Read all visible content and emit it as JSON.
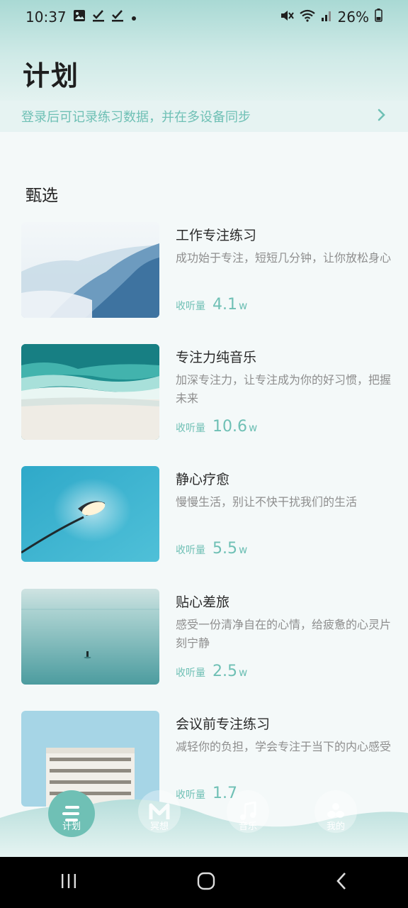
{
  "status_bar": {
    "time": "10:37",
    "battery": "26%"
  },
  "page": {
    "title": "计划"
  },
  "login_banner": {
    "text": "登录后可记录练习数据，并在多设备同步"
  },
  "section": {
    "title": "甄选"
  },
  "items": [
    {
      "title": "工作专注练习",
      "desc": "成功始于专注，短短几分钟，让你放松身心",
      "count_label": "收听量",
      "count": "4.1",
      "unit": "w"
    },
    {
      "title": "专注力纯音乐",
      "desc": "加深专注力，让专注成为你的好习惯，把握未来",
      "count_label": "收听量",
      "count": "10.6",
      "unit": "w"
    },
    {
      "title": "静心疗愈",
      "desc": "慢慢生活，别让不快干扰我们的生活",
      "count_label": "收听量",
      "count": "5.5",
      "unit": "w"
    },
    {
      "title": "贴心差旅",
      "desc": "感受一份清净自在的心情，给疲惫的心灵片刻宁静",
      "count_label": "收听量",
      "count": "2.5",
      "unit": "w"
    },
    {
      "title": "会议前专注练习",
      "desc": "减轻你的负担，学会专注于当下的内心感受",
      "count_label": "收听量",
      "count": "1.7",
      "unit": ""
    }
  ],
  "nav": [
    {
      "label": "计划",
      "icon": "plan-icon",
      "active": true
    },
    {
      "label": "冥想",
      "icon": "meditation-m-icon",
      "active": false
    },
    {
      "label": "音乐",
      "icon": "music-note-icon",
      "active": false
    },
    {
      "label": "我的",
      "icon": "profile-lotus-icon",
      "active": false
    }
  ],
  "colors": {
    "accent": "#6fc0b5",
    "header": "#a9d9d4",
    "nav_wave": "#b7dedb"
  }
}
